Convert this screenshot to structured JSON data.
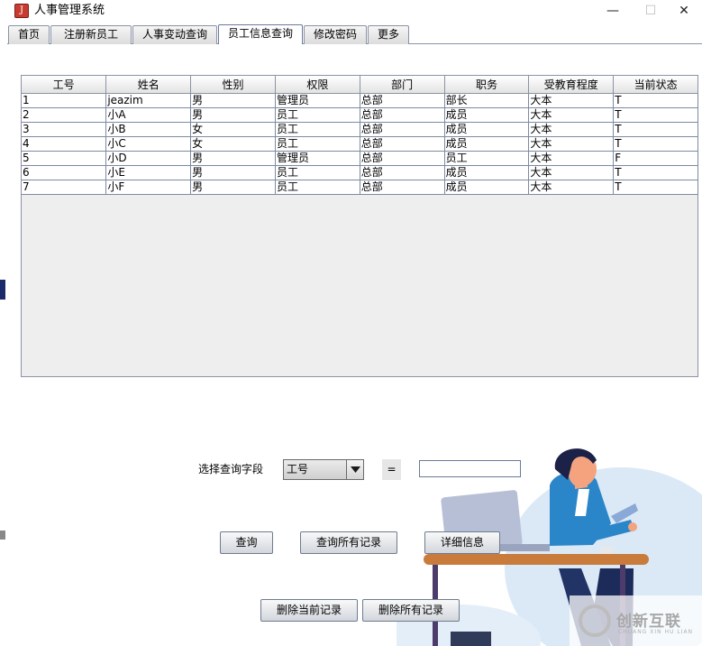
{
  "window": {
    "title": "人事管理系统",
    "minimize": "—",
    "maximize": "☐",
    "close": "✕"
  },
  "tabs": [
    {
      "label": "首页"
    },
    {
      "label": "注册新员工"
    },
    {
      "label": "人事变动查询"
    },
    {
      "label": "员工信息查询",
      "active": true
    },
    {
      "label": "修改密码"
    },
    {
      "label": "更多"
    }
  ],
  "table": {
    "columns": [
      "工号",
      "姓名",
      "性别",
      "权限",
      "部门",
      "职务",
      "受教育程度",
      "当前状态"
    ],
    "rows": [
      [
        "1",
        "jeazim",
        "男",
        "管理员",
        "总部",
        "部长",
        "大本",
        "T"
      ],
      [
        "2",
        "小A",
        "男",
        "员工",
        "总部",
        "成员",
        "大本",
        "T"
      ],
      [
        "3",
        "小B",
        "女",
        "员工",
        "总部",
        "成员",
        "大本",
        "T"
      ],
      [
        "4",
        "小C",
        "女",
        "员工",
        "总部",
        "成员",
        "大本",
        "T"
      ],
      [
        "5",
        "小D",
        "男",
        "管理员",
        "总部",
        "员工",
        "大本",
        "F"
      ],
      [
        "6",
        "小E",
        "男",
        "员工",
        "总部",
        "成员",
        "大本",
        "T"
      ],
      [
        "7",
        "小F",
        "男",
        "员工",
        "总部",
        "成员",
        "大本",
        "T"
      ]
    ]
  },
  "query": {
    "field_label": "选择查询字段",
    "selected_field": "工号",
    "equals": "=",
    "value": ""
  },
  "buttons": {
    "query": "查询",
    "query_all": "查询所有记录",
    "detail": "详细信息",
    "delete_current": "删除当前记录",
    "delete_all": "删除所有记录"
  },
  "watermark": {
    "text": "创新互联",
    "subtext": "CHUANG XIN HU LIAN"
  },
  "colors": {
    "tab_border": "#8a93a5",
    "table_bg": "#eeeeee",
    "button_border": "#6f7b8f"
  }
}
